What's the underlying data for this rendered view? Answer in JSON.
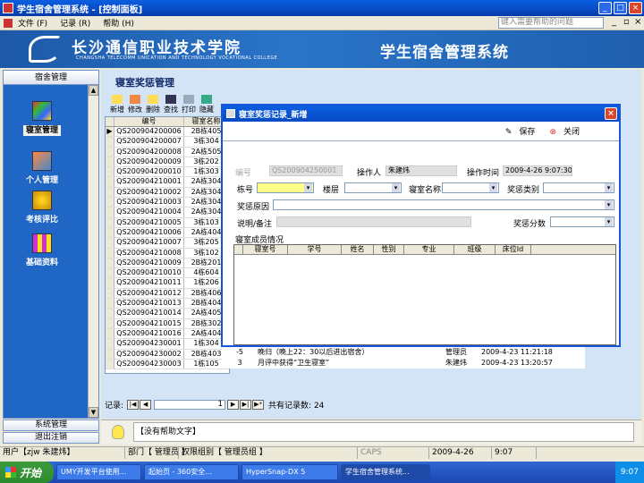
{
  "window": {
    "title": "学生宿舍管理系统 - [控制面板]"
  },
  "menu": {
    "items": [
      "文件 (F)",
      "记录 (R)",
      "帮助 (H)"
    ],
    "help_placeholder": "键入需要帮助的问题"
  },
  "banner": {
    "school": "长沙通信职业技术学院",
    "school_en": "CHANGSHA TELECOMM UNICATION AND TECHNOLOGY VOCATIONAL COLLEGE",
    "system": "学生宿舍管理系统"
  },
  "sidebar": {
    "header": "宿舍管理",
    "items": [
      {
        "label": "寝室管理",
        "active": true
      },
      {
        "label": "个人管理"
      },
      {
        "label": "考核评比"
      },
      {
        "label": "基础资料"
      }
    ],
    "bottom": [
      "系统管理",
      "退出注销"
    ]
  },
  "main": {
    "title": "寝室奖惩管理",
    "toolbar": [
      "新增",
      "修改",
      "删除",
      "查找",
      "打印",
      "隐藏"
    ],
    "grid": {
      "headers": [
        "编号",
        "寝室名称"
      ],
      "rows": [
        [
          "QS200904200006",
          "2B栋405"
        ],
        [
          "QS200904200007",
          "3栋304"
        ],
        [
          "QS200904200008",
          "2A栋505"
        ],
        [
          "QS200904200009",
          "3栋202"
        ],
        [
          "QS200904200010",
          "1栋303"
        ],
        [
          "QS200904210001",
          "2A栋304"
        ],
        [
          "QS200904210002",
          "2A栋304"
        ],
        [
          "QS200904210003",
          "2A栋304"
        ],
        [
          "QS200904210004",
          "2A栋304"
        ],
        [
          "QS200904210005",
          "3栋103"
        ],
        [
          "QS200904210006",
          "2A栋404"
        ],
        [
          "QS200904210007",
          "3栋205"
        ],
        [
          "QS200904210008",
          "3栋102"
        ],
        [
          "QS200904210009",
          "2B栋201"
        ],
        [
          "QS200904210010",
          "4栋604"
        ],
        [
          "QS200904210011",
          "1栋206"
        ],
        [
          "QS200904210012",
          "2B栋406"
        ],
        [
          "QS200904210013",
          "2B栋404"
        ],
        [
          "QS200904210014",
          "2A栋405"
        ],
        [
          "QS200904210015",
          "2B栋302"
        ],
        [
          "QS200904210016",
          "2A栋404"
        ],
        [
          "QS200904230001",
          "1栋304"
        ],
        [
          "QS200904230002",
          "2B栋403"
        ],
        [
          "QS200904230003",
          "1栋105"
        ]
      ]
    },
    "detail_rows": [
      [
        "-5",
        "晚归（晚上22：30以后进出宿舍）",
        "管理员",
        "2009-4-23 11:21:18"
      ],
      [
        "3",
        "月评中获得“卫生寝室”",
        "朱建炜",
        "2009-4-23 13:20:57"
      ]
    ],
    "nav": {
      "label": "记录:",
      "current": "1",
      "total": "共有记录数: 24"
    }
  },
  "dialog": {
    "title": "寝室奖惩记录_新增",
    "save": "保存",
    "close": "关闭",
    "labels": {
      "id": "编号",
      "operator": "操作人",
      "op_time": "操作时间",
      "building": "栋号",
      "floor": "楼层",
      "room": "寝室名称",
      "category": "奖惩类别",
      "reason": "奖惩原因",
      "remark": "说明/备注",
      "score": "奖惩分数",
      "members": "寝室成员情况"
    },
    "values": {
      "id": "QS200904250001",
      "operator": "朱建炜",
      "op_time": "2009-4-26 9:07:30"
    },
    "member_headers": [
      "寝室号",
      "学号",
      "姓名",
      "性别",
      "专业",
      "班级",
      "床位Id"
    ]
  },
  "help": {
    "text": "【没有帮助文字】"
  },
  "status": {
    "user": "用户【zjw 朱建炜】",
    "dept": "部门【 管理员 】",
    "perm": "权限组别【 管理员组 】",
    "caps": "CAPS",
    "date": "2009-4-26",
    "time": "9:07"
  },
  "taskbar": {
    "start": "开始",
    "buttons": [
      "UMY开发平台使用...",
      "起始页 - 360安全...",
      "HyperSnap-DX 5",
      "学生宿舍管理系统..."
    ],
    "clock": "9:07"
  }
}
